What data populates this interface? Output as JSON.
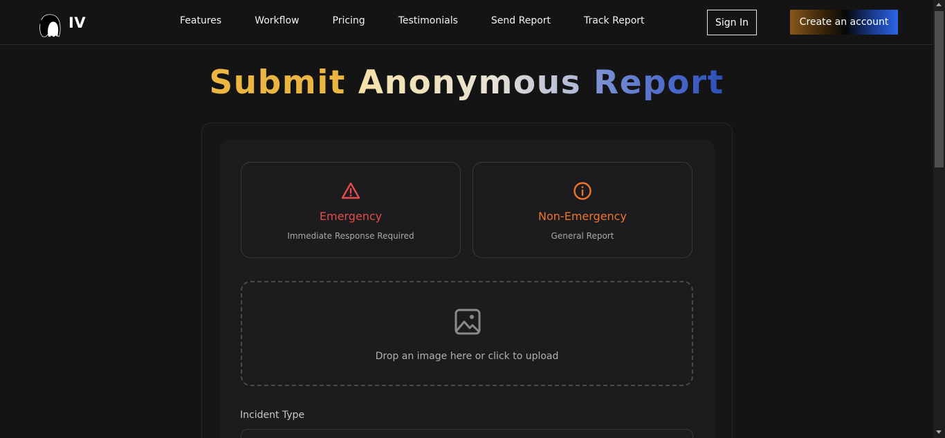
{
  "brand": {
    "name": "IV",
    "logo_icon": "ghost-logo-icon"
  },
  "nav": {
    "links": [
      "Features",
      "Workflow",
      "Pricing",
      "Testimonials",
      "Send Report",
      "Track Report"
    ],
    "sign_in": "Sign In",
    "create_account": "Create an account"
  },
  "title": {
    "part1": "Submit",
    "part2": "Anonymous",
    "part3": "Report"
  },
  "report_types": [
    {
      "title": "Emergency",
      "subtitle": "Immediate Response Required",
      "icon": "warning-triangle-icon",
      "color": "#e74c4c"
    },
    {
      "title": "Non-Emergency",
      "subtitle": "General Report",
      "icon": "info-circle-icon",
      "color": "#f0732a"
    }
  ],
  "upload": {
    "text": "Drop an image here or click to upload",
    "icon": "image-icon"
  },
  "incident_type": {
    "label": "Incident Type"
  },
  "colors": {
    "background": "#141414",
    "gold": "#eab540",
    "blue": "#2e64e6"
  }
}
